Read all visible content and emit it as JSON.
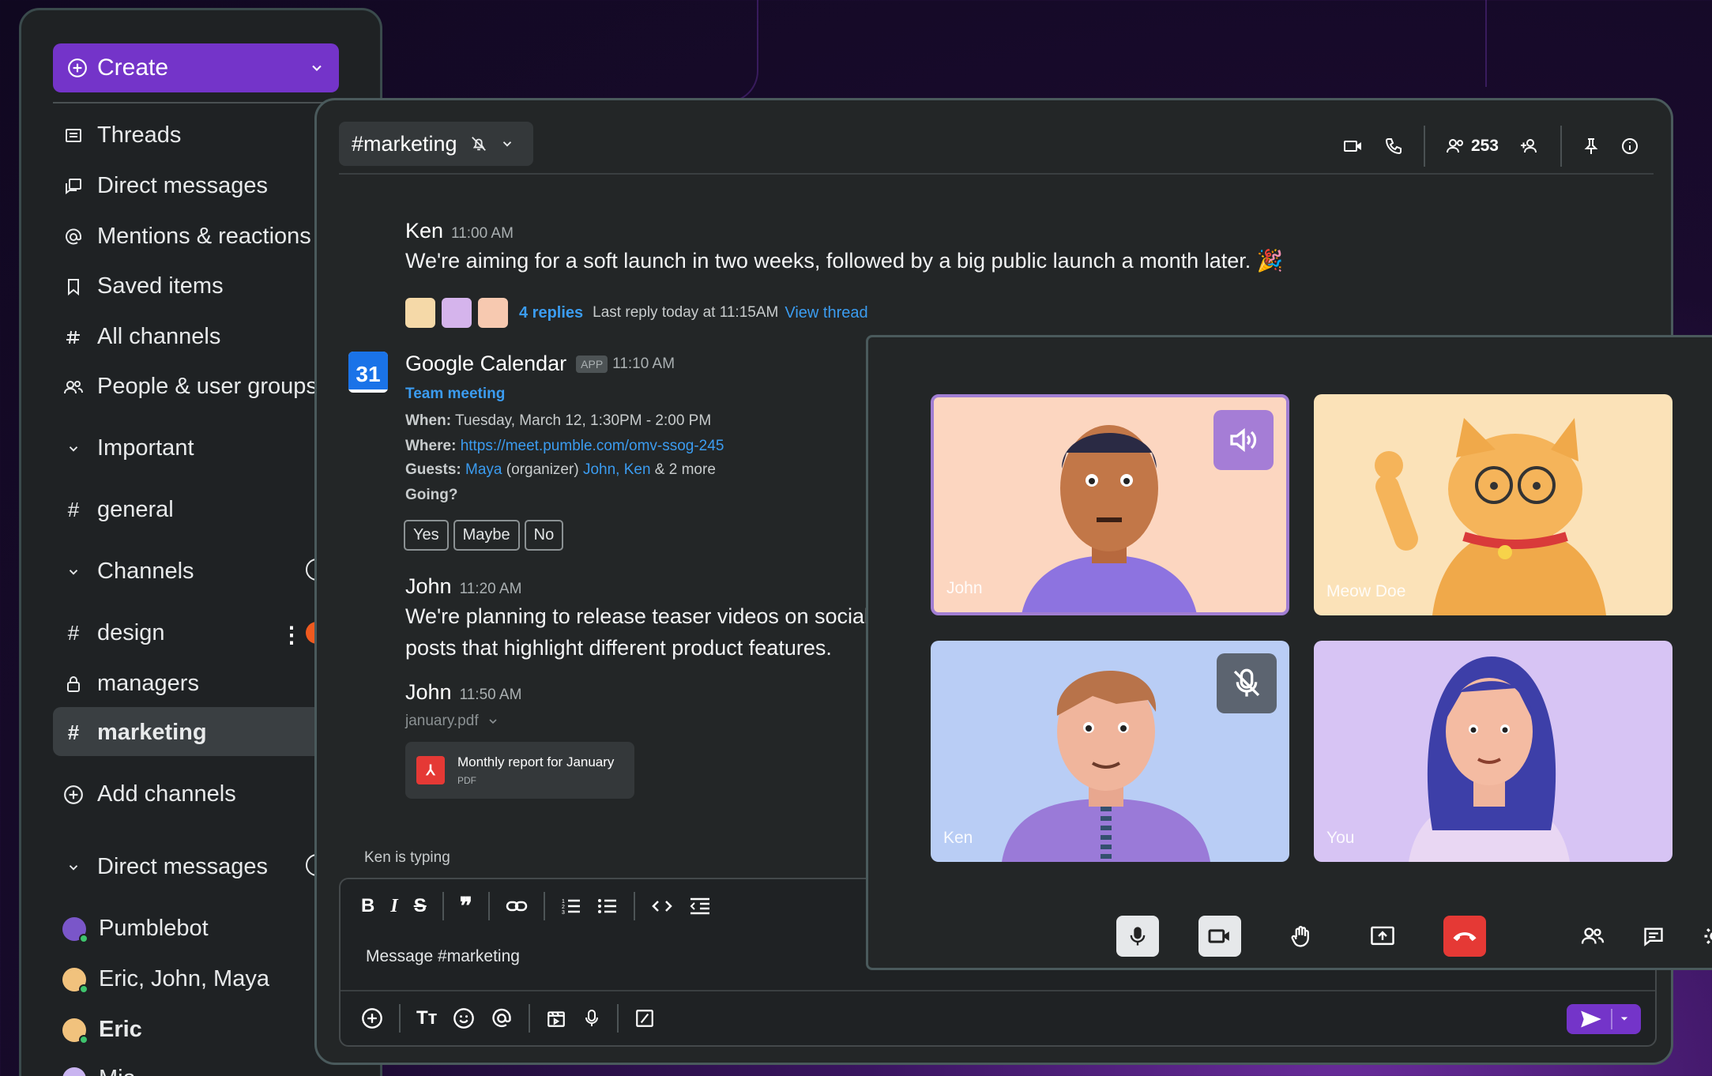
{
  "sidebar": {
    "create_label": "Create",
    "nav": [
      {
        "label": "Threads",
        "icon": "threads-icon"
      },
      {
        "label": "Direct messages",
        "icon": "direct-messages-icon"
      },
      {
        "label": "Mentions & reactions",
        "icon": "mention-icon"
      },
      {
        "label": "Saved items",
        "icon": "bookmark-icon"
      },
      {
        "label": "All channels",
        "icon": "all-channels-icon"
      },
      {
        "label": "People & user groups",
        "icon": "people-icon"
      }
    ],
    "sections": {
      "important": "Important",
      "channels": "Channels",
      "direct_messages": "Direct messages"
    },
    "important_channels": [
      "general"
    ],
    "channels": [
      "design",
      "managers",
      "marketing"
    ],
    "add_channels": "Add channels",
    "dms": [
      "Pumblebot",
      "Eric, John, Maya",
      "Eric",
      "Mia"
    ]
  },
  "header": {
    "channel": "#marketing",
    "members_count": "253"
  },
  "messages": {
    "m1": {
      "author": "Ken",
      "time": "11:00 AM",
      "text": "We're aiming for a soft launch in two weeks, followed by a big public launch a month later. 🎉"
    },
    "thread": {
      "replies": "4 replies",
      "last_reply": "Last reply today at 11:15AM",
      "view": "View thread"
    },
    "calendar": {
      "icon_day": "31",
      "author": "Google Calendar",
      "badge": "APP",
      "time": "11:10 AM",
      "event": "Team meeting",
      "when_label": "When:",
      "when": "Tuesday, March 12, 1:30PM - 2:00 PM",
      "where_label": "Where:",
      "where": "https://meet.pumble.com/omv-ssog-245",
      "guests_label": "Guests:",
      "guest1": "Maya",
      "organizer": "(organizer)",
      "guest2": "John,",
      "guest3": "Ken",
      "more": "& 2 more",
      "going": "Going?",
      "yes": "Yes",
      "maybe": "Maybe",
      "no": "No"
    },
    "m2": {
      "author": "John",
      "time": "11:20 AM",
      "text1": "We're planning to release teaser videos on social",
      "text2": "posts that highlight different product features."
    },
    "m3": {
      "author": "John",
      "time": "11:50 AM",
      "file": "january.pdf",
      "pdf_title": "Monthly report for January",
      "pdf_type": "PDF"
    }
  },
  "typing": "Ken is typing",
  "composer": {
    "placeholder": "Message #marketing"
  },
  "call": {
    "tiles": [
      "John",
      "Meow Doe",
      "Ken",
      "You"
    ]
  },
  "colors": {
    "accent": "#7434c9",
    "link": "#3b9cf0",
    "hangup": "#e53935"
  }
}
